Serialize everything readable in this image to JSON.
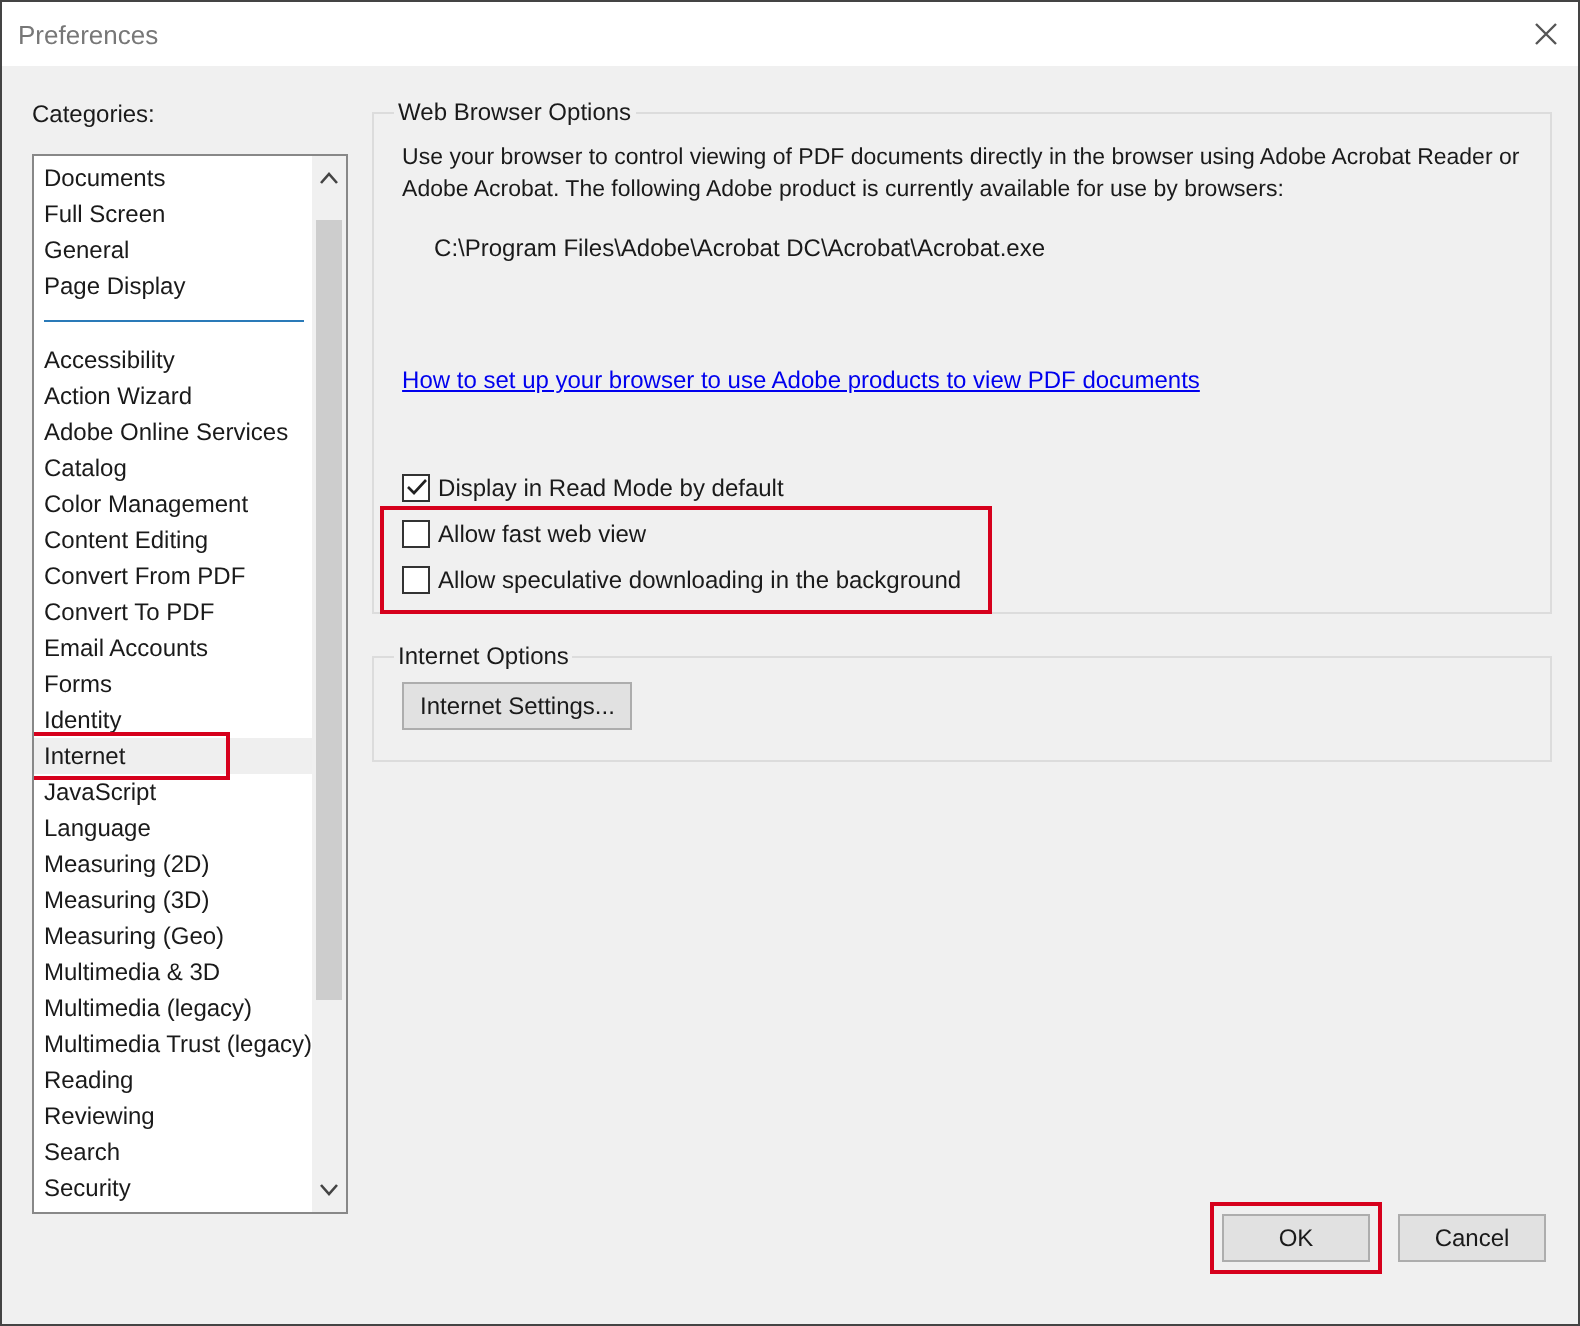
{
  "window": {
    "title": "Preferences"
  },
  "categories": {
    "label": "Categories:",
    "groups": [
      {
        "items": [
          {
            "label": "Documents",
            "selected": false,
            "highlighted": false
          },
          {
            "label": "Full Screen",
            "selected": false,
            "highlighted": false
          },
          {
            "label": "General",
            "selected": false,
            "highlighted": false
          },
          {
            "label": "Page Display",
            "selected": false,
            "highlighted": false
          }
        ]
      },
      {
        "items": [
          {
            "label": "Accessibility",
            "selected": false,
            "highlighted": false
          },
          {
            "label": "Action Wizard",
            "selected": false,
            "highlighted": false
          },
          {
            "label": "Adobe Online Services",
            "selected": false,
            "highlighted": false
          },
          {
            "label": "Catalog",
            "selected": false,
            "highlighted": false
          },
          {
            "label": "Color Management",
            "selected": false,
            "highlighted": false
          },
          {
            "label": "Content Editing",
            "selected": false,
            "highlighted": false
          },
          {
            "label": "Convert From PDF",
            "selected": false,
            "highlighted": false
          },
          {
            "label": "Convert To PDF",
            "selected": false,
            "highlighted": false
          },
          {
            "label": "Email Accounts",
            "selected": false,
            "highlighted": false
          },
          {
            "label": "Forms",
            "selected": false,
            "highlighted": false
          },
          {
            "label": "Identity",
            "selected": false,
            "highlighted": false
          },
          {
            "label": "Internet",
            "selected": true,
            "highlighted": true
          },
          {
            "label": "JavaScript",
            "selected": false,
            "highlighted": false
          },
          {
            "label": "Language",
            "selected": false,
            "highlighted": false
          },
          {
            "label": "Measuring (2D)",
            "selected": false,
            "highlighted": false
          },
          {
            "label": "Measuring (3D)",
            "selected": false,
            "highlighted": false
          },
          {
            "label": "Measuring (Geo)",
            "selected": false,
            "highlighted": false
          },
          {
            "label": "Multimedia & 3D",
            "selected": false,
            "highlighted": false
          },
          {
            "label": "Multimedia (legacy)",
            "selected": false,
            "highlighted": false
          },
          {
            "label": "Multimedia Trust (legacy)",
            "selected": false,
            "highlighted": false
          },
          {
            "label": "Reading",
            "selected": false,
            "highlighted": false
          },
          {
            "label": "Reviewing",
            "selected": false,
            "highlighted": false
          },
          {
            "label": "Search",
            "selected": false,
            "highlighted": false
          },
          {
            "label": "Security",
            "selected": false,
            "highlighted": false
          }
        ]
      }
    ]
  },
  "web_browser_options": {
    "title": "Web Browser Options",
    "description": "Use your browser to control viewing of PDF documents directly in the browser using Adobe Acrobat Reader or Adobe Acrobat. The following Adobe product is currently available for use by browsers:",
    "path": "C:\\Program Files\\Adobe\\Acrobat DC\\Acrobat\\Acrobat.exe",
    "link": "How to set up your browser to use Adobe products to view PDF documents",
    "checkbox_groups": [
      {
        "highlighted": false,
        "items": [
          {
            "label": "Display in Read Mode by default",
            "checked": true
          }
        ]
      },
      {
        "highlighted": true,
        "items": [
          {
            "label": "Allow fast web view",
            "checked": false
          },
          {
            "label": "Allow speculative downloading in the background",
            "checked": false
          }
        ]
      }
    ]
  },
  "internet_options": {
    "title": "Internet Options",
    "button": "Internet Settings..."
  },
  "buttons": [
    {
      "label": "OK",
      "highlighted": true
    },
    {
      "label": "Cancel",
      "highlighted": false
    }
  ]
}
